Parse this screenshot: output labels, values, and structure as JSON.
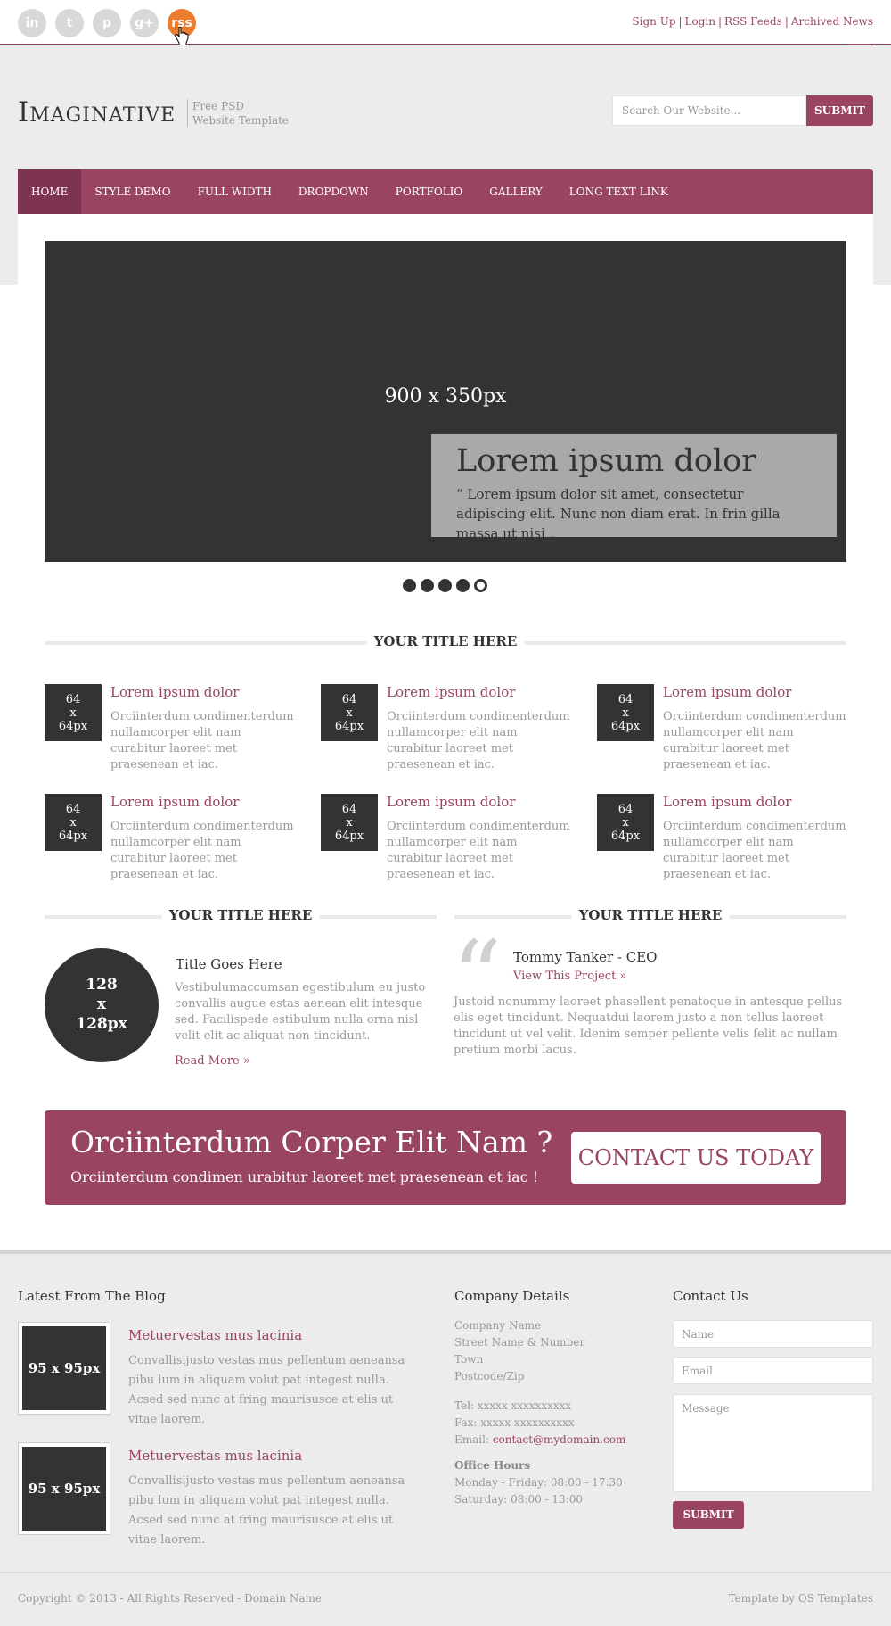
{
  "topbar": {
    "social": [
      {
        "icon": "linkedin-icon",
        "glyph": "in"
      },
      {
        "icon": "twitter-icon",
        "glyph": "t"
      },
      {
        "icon": "pinterest-icon",
        "glyph": "p"
      },
      {
        "icon": "google-plus-icon",
        "glyph": "g+"
      },
      {
        "icon": "rss-icon",
        "glyph": "rss"
      }
    ],
    "links": [
      "Sign Up",
      "Login",
      "RSS Feeds",
      "Archived News"
    ],
    "toggle_label": "–"
  },
  "header": {
    "logo": "Imaginative",
    "tagline_line1": "Free PSD",
    "tagline_line2": "Website Template",
    "search_placeholder": "Search Our Website...",
    "search_button": "SUBMIT"
  },
  "nav": {
    "items": [
      "HOME",
      "STYLE DEMO",
      "FULL WIDTH",
      "DROPDOWN",
      "PORTFOLIO",
      "GALLERY",
      "LONG TEXT LINK"
    ]
  },
  "slider": {
    "placeholder": "900 x 350px",
    "caption_title": "Lorem ipsum dolor",
    "caption_text": "“ Lorem ipsum dolor sit amet, consectetur adipiscing elit. Nunc non diam erat. In frin gilla massa ut nisi „",
    "slide_count": 5,
    "active_slide": 5
  },
  "features": {
    "title": "YOUR TITLE HERE",
    "items": [
      {
        "thumb1": "64",
        "thumb2": "x",
        "thumb3": "64px",
        "heading": "Lorem ipsum dolor",
        "text": "Orciinterdum condimenterdum nullamcorper elit nam curabitur laoreet met praesenean et iac."
      },
      {
        "thumb1": "64",
        "thumb2": "x",
        "thumb3": "64px",
        "heading": "Lorem ipsum dolor",
        "text": "Orciinterdum condimenterdum nullamcorper elit nam curabitur laoreet met praesenean et iac."
      },
      {
        "thumb1": "64",
        "thumb2": "x",
        "thumb3": "64px",
        "heading": "Lorem ipsum dolor",
        "text": "Orciinterdum condimenterdum nullamcorper elit nam curabitur laoreet met praesenean et iac."
      },
      {
        "thumb1": "64",
        "thumb2": "x",
        "thumb3": "64px",
        "heading": "Lorem ipsum dolor",
        "text": "Orciinterdum condimenterdum nullamcorper elit nam curabitur laoreet met praesenean et iac."
      },
      {
        "thumb1": "64",
        "thumb2": "x",
        "thumb3": "64px",
        "heading": "Lorem ipsum dolor",
        "text": "Orciinterdum condimenterdum nullamcorper elit nam curabitur laoreet met praesenean et iac."
      },
      {
        "thumb1": "64",
        "thumb2": "x",
        "thumb3": "64px",
        "heading": "Lorem ipsum dolor",
        "text": "Orciinterdum condimenterdum nullamcorper elit nam curabitur laoreet met praesenean et iac."
      }
    ]
  },
  "left_column": {
    "title": "YOUR TITLE HERE",
    "circle1": "128",
    "circle2": "x",
    "circle3": "128px",
    "heading": "Title Goes Here",
    "text": "Vestibulumaccumsan egestibulum eu justo convallis augue estas aenean elit intesque sed. Facilispede estibulum nulla orna nisl velit elit ac aliquat non tincidunt.",
    "read_more": "Read More »"
  },
  "right_column": {
    "title": "YOUR TITLE HERE",
    "quote_glyph": "“",
    "name": "Tommy Tanker - CEO",
    "link": "View This Project »",
    "text": "Justoid nonummy laoreet phasellent penatoque in antesque pellus elis eget tincidunt. Nequatdui laorem justo a non tellus laoreet tincidunt ut vel velit. Idenim semper pellente velis felit ac nullam pretium morbi lacus."
  },
  "cta": {
    "heading": "Orciinterdum Corper Elit Nam ?",
    "subheading": "Orciinterdum condimen urabitur laoreet met praesenean et iac !",
    "button": "CONTACT US TODAY"
  },
  "footer": {
    "blog_heading": "Latest From The Blog",
    "posts": [
      {
        "thumb": "95 x 95px",
        "title": "Metuervestas mus lacinia",
        "text": "Convallisijusto vestas mus pellentum aeneansa pibu lum in aliquam volut pat integest nulla. Acsed sed nunc at fring maurisusce at elis ut vitae laorem."
      },
      {
        "thumb": "95 x 95px",
        "title": "Metuervestas mus lacinia",
        "text": "Convallisijusto vestas mus pellentum aeneansa pibu lum in aliquam volut pat integest nulla. Acsed sed nunc at fring maurisusce at elis ut vitae laorem."
      }
    ],
    "company_heading": "Company Details",
    "company_lines": [
      "Company Name",
      "Street Name & Number",
      "Town",
      "Postcode/Zip"
    ],
    "tel": "Tel: xxxxx xxxxxxxxxx",
    "fax": "Fax: xxxxx xxxxxxxxxx",
    "email_label": "Email: ",
    "email": "contact@mydomain.com",
    "hours_heading": "Office Hours",
    "hours_weekday": "Monday - Friday: 08:00 - 17:30",
    "hours_saturday": "Saturday: 08:00 - 13:00",
    "contact_heading": "Contact Us",
    "name_placeholder": "Name",
    "email_placeholder": "Email",
    "message_placeholder": "Message",
    "submit": "SUBMIT",
    "copyright": "Copyright © 2013 - All Rights Reserved - Domain Name",
    "credit": "Template by OS Templates"
  },
  "colors": {
    "accent": "#9a4560",
    "rss": "#ec7b2d",
    "dark": "#333333"
  }
}
